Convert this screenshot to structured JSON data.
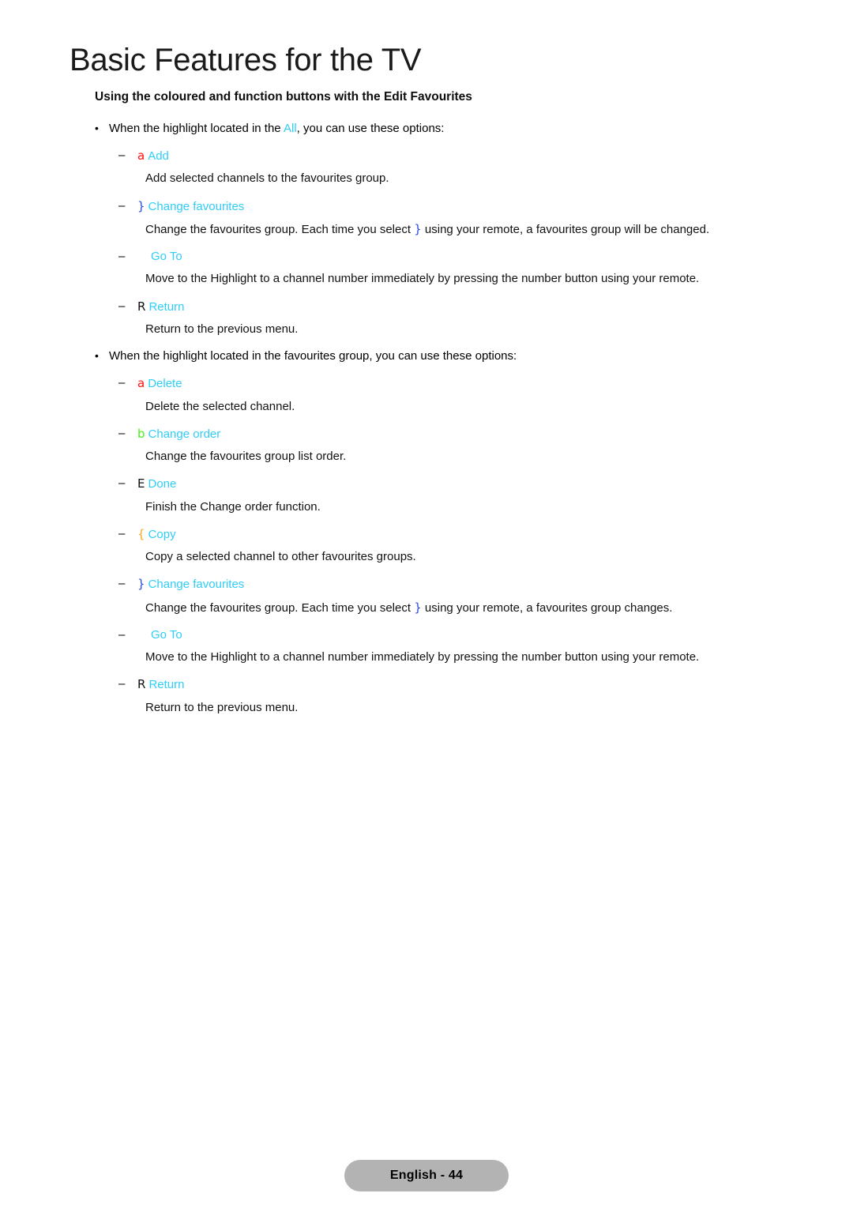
{
  "document": {
    "title": "Basic Features for the TV",
    "section_heading": "Using the coloured and function buttons with the Edit Favourites"
  },
  "colors": {
    "cyan": "#2fcdf7",
    "red": "#ff0f0f",
    "green": "#4cf01a",
    "blue": "#2a4ae0",
    "orange": "#f5a623",
    "black": "#111111",
    "footer_bg": "#b3b3b3"
  },
  "groups": [
    {
      "intro": {
        "prefix": "When the highlight located in the ",
        "token": "All",
        "suffix": ", you can use these options:"
      },
      "items": [
        {
          "glyph": "a",
          "glyph_color": "red",
          "label": "Add",
          "desc": "Add selected channels to the favourites group."
        },
        {
          "glyph": "}",
          "glyph_color": "blue",
          "label": "Change favourites",
          "desc_prefix": "Change the favourites group. Each time you select ",
          "desc_token": "}",
          "desc_suffix": " using your remote, a favourites group will be changed."
        },
        {
          "glyph": "",
          "glyph_color": "blank",
          "label": "Go To",
          "desc": "Move to the Highlight to a channel number immediately by pressing the number button using your remote."
        },
        {
          "glyph": "R",
          "glyph_color": "black",
          "label": "Return",
          "desc": "Return to the previous menu."
        }
      ]
    },
    {
      "intro": {
        "prefix": "When the highlight located in the favourites group, you can use these options:",
        "token": "",
        "suffix": ""
      },
      "items": [
        {
          "glyph": "a",
          "glyph_color": "red",
          "label": "Delete",
          "desc": "Delete the selected channel."
        },
        {
          "glyph": "b",
          "glyph_color": "green",
          "label": "Change order",
          "desc": "Change the favourites group list order."
        },
        {
          "glyph": "E",
          "glyph_color": "black",
          "label": "Done",
          "desc": "Finish the Change order function."
        },
        {
          "glyph": "{",
          "glyph_color": "orange",
          "label": "Copy",
          "desc": "Copy a selected channel to other favourites groups."
        },
        {
          "glyph": "}",
          "glyph_color": "blue",
          "label": "Change favourites",
          "desc_prefix": "Change the favourites group. Each time you select ",
          "desc_token": "}",
          "desc_suffix": " using your remote, a favourites group changes."
        },
        {
          "glyph": "",
          "glyph_color": "blank",
          "label": "Go To",
          "desc": "Move to the Highlight to a channel number immediately by pressing the number button using your remote."
        },
        {
          "glyph": "R",
          "glyph_color": "black",
          "label": "Return",
          "desc": "Return to the previous menu."
        }
      ]
    }
  ],
  "marks": {
    "bullet": "•",
    "dash": "–"
  },
  "footer": {
    "label": "English - 44"
  }
}
